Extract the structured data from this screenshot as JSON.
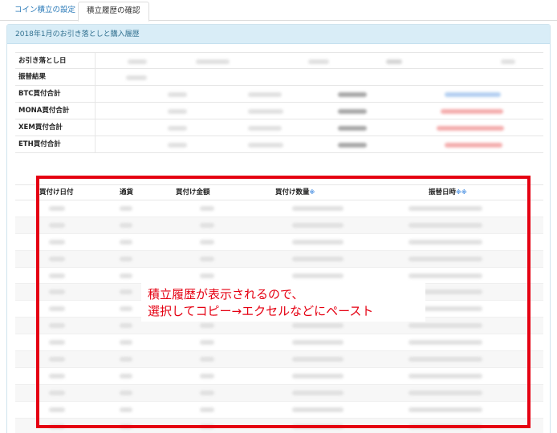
{
  "tabs": [
    {
      "label": "コイン積立の設定"
    },
    {
      "label": "積立履歴の確認"
    }
  ],
  "panel": {
    "title": "2018年1月のお引き落としと購入履歴"
  },
  "summary": {
    "rows": [
      {
        "label": "お引き落とし日"
      },
      {
        "label": "振替結果"
      },
      {
        "label": "BTC買付合計"
      },
      {
        "label": "MONA買付合計"
      },
      {
        "label": "XEM買付合計"
      },
      {
        "label": "ETH買付合計"
      }
    ]
  },
  "history": {
    "headers": {
      "date": "買付け日付",
      "currency": "通貨",
      "amount": "買付け金額",
      "quantity": "買付け数量",
      "quantity_sort": "※",
      "transfer_time": "振替日時",
      "transfer_sort": "※※"
    },
    "rows": [
      {
        "date": "02/10",
        "currency": "BTC",
        "amount": "3??",
        "quantity": "0.0000413?BTC",
        "time": "2018-02-11 07:34:03.866248"
      },
      {
        "date": "02/10",
        "currency": "ETH",
        "amount": "7??",
        "quantity": "0.000717?ETH",
        "time": "2018-02-11 07:34:03.866248"
      },
      {
        "date": "02/10",
        "currency": "MONA",
        "amount": "10??",
        "quantity": "0.2279?MONA",
        "time": "2018-02-11 07:34:03.866248"
      },
      {
        "date": "02/10",
        "currency": "XEM",
        "amount": "14??",
        "quantity": "2.1473?XEM",
        "time": "2018-02-11 07:34:03.866248"
      },
      {
        "date": "02/11",
        "currency": "BTC",
        "amount": "3??",
        "quantity": "0.0000410?BTC",
        "time": "2018-02-12 07:11:05.353641"
      },
      {
        "date": "02/11",
        "currency": "ETH",
        "amount": "7??",
        "quantity": "0.000796?ETH",
        "time": "2018-02-12 07:11:05.353641"
      },
      {
        "date": "02/11",
        "currency": "MONA",
        "amount": "10??",
        "quantity": "0.2219?MONA",
        "time": "2018-02-12 07:11:05.353641"
      },
      {
        "date": "02/11",
        "currency": "XEM",
        "amount": "14??",
        "quantity": "2.1319?XEM",
        "time": "2018-02-12 07:11:05.353641"
      },
      {
        "date": "02/12",
        "currency": "BTC",
        "amount": "3??",
        "quantity": "0.0000398?BTC",
        "time": "2018-02-13 07:14:56.145103"
      },
      {
        "date": "02/12",
        "currency": "ETH",
        "amount": "7??",
        "quantity": "0.000838?ETH",
        "time": "2018-02-13 07:14:56.145103"
      },
      {
        "date": "02/12",
        "currency": "MONA",
        "amount": "10??",
        "quantity": "0.2713?MONA",
        "time": "2018-02-13 07:14:56.145103"
      },
      {
        "date": "02/12",
        "currency": "XEM",
        "amount": "14??",
        "quantity": "2.4253?XEM",
        "time": "2018-02-13 07:14:56.145103"
      },
      {
        "date": "02/13",
        "currency": "BTC",
        "amount": "3??",
        "quantity": "0.0000362?BTC",
        "time": "2018-02-14 07:23:56.207416"
      },
      {
        "date": "02/13",
        "currency": "ETH",
        "amount": "7??",
        "quantity": "0.000742?ETH",
        "time": "2018-02-14 07:23:56.207416"
      },
      {
        "date": "02/13",
        "currency": "MONA",
        "amount": "10??",
        "quantity": "0.2213?MONA",
        "time": "2018-02-14 07:23:56.207416"
      }
    ]
  },
  "annotation": {
    "line1": "積立履歴が表示されるので、",
    "line2": "選択してコピー→エクセルなどにペースト"
  },
  "colors": {
    "annotation_red": "#e50012",
    "panel_head_bg": "#d9edf7",
    "tab_link": "#2a7ab8"
  }
}
